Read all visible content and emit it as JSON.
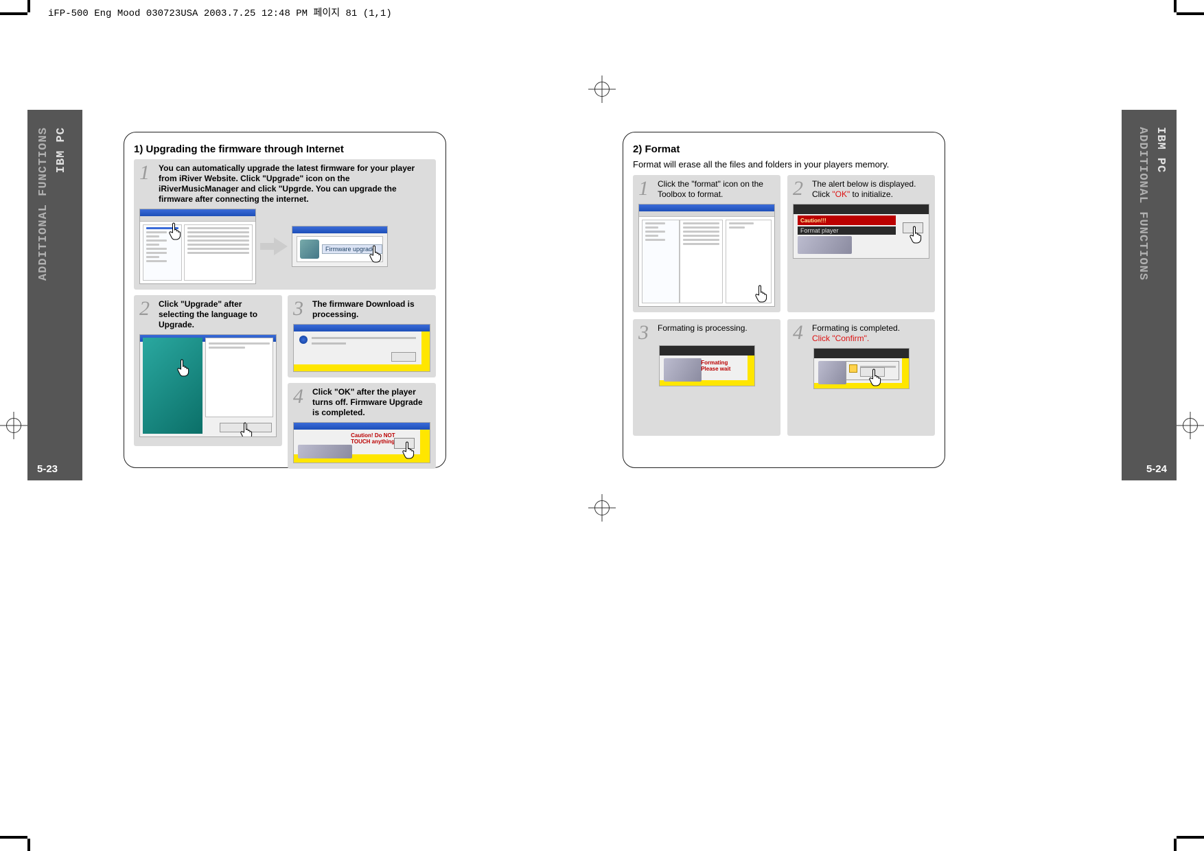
{
  "doc_header": "iFP-500 Eng Mood 030723USA  2003.7.25  12:48 PM  페이지 81 (1,1)",
  "left": {
    "tab_line1": "ADDITIONAL FUNCTIONS",
    "tab_line2": "IBM PC",
    "page_num": "5-23",
    "title": "1) Upgrading the firmware through Internet",
    "step1": "You can automatically upgrade the latest firmware for your player from iRiver Website. Click \"Upgrade\" icon on the iRiverMusicManager and click \"Upgrde. You can upgrade the firmware after connecting the internet.",
    "step2": "Click \"Upgrade\" after selecting the language to Upgrade.",
    "step3": "The firmware Download is processing.",
    "step4": "Click \"OK\" after the player turns off. Firmware Upgrade is completed.",
    "shot_b_label": "Firmware upgrade",
    "shot_e_caution": "Caution! Do NOT TOUCH anything"
  },
  "right": {
    "tab_line1": "IBM PC",
    "tab_line2": "ADDITIONAL FUNCTIONS",
    "page_num": "5-24",
    "title": "2) Format",
    "subtitle": "Format will erase all the files and folders in your players memory.",
    "step1": "Click the \"format\" icon on the Toolbox to format.",
    "step2_a": "The alert below is displayed. Click ",
    "step2_ok": "\"OK\"",
    "step2_b": " to initialize.",
    "step3": "Formating is processing.",
    "step4_a": "Formating is completed.",
    "step4_b": "Click \"Confirm\".",
    "shot2_caution": "Caution!!!",
    "shot2_sub": "Format player",
    "shot3_label": "Formating Please wait"
  }
}
